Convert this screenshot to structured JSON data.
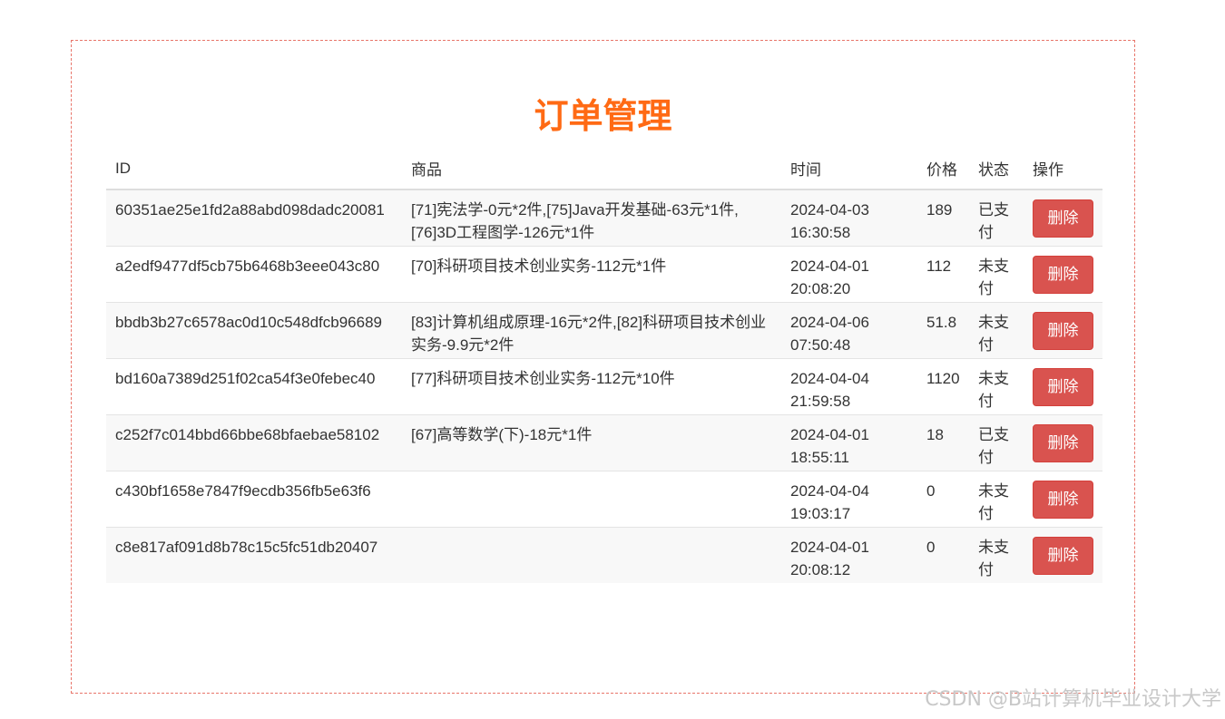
{
  "page": {
    "title": "订单管理"
  },
  "table": {
    "headers": [
      "ID",
      "商品",
      "时间",
      "价格",
      "状态",
      "操作"
    ],
    "rows": [
      {
        "id": "60351ae25e1fd2a88abd098dadc20081",
        "goods": "[71]宪法学-0元*2件,[75]Java开发基础-63元*1件,[76]3D工程图学-126元*1件",
        "time_date": "2024-04-03",
        "time_clock": "16:30:58",
        "price": "189",
        "status": "已支付",
        "action": "删除"
      },
      {
        "id": "a2edf9477df5cb75b6468b3eee043c80",
        "goods": "[70]科研项目技术创业实务-112元*1件",
        "time_date": "2024-04-01",
        "time_clock": "20:08:20",
        "price": "112",
        "status": "未支付",
        "action": "删除"
      },
      {
        "id": "bbdb3b27c6578ac0d10c548dfcb96689",
        "goods": "[83]计算机组成原理-16元*2件,[82]科研项目技术创业实务-9.9元*2件",
        "time_date": "2024-04-06",
        "time_clock": "07:50:48",
        "price": "51.8",
        "status": "未支付",
        "action": "删除"
      },
      {
        "id": "bd160a7389d251f02ca54f3e0febec40",
        "goods": "[77]科研项目技术创业实务-112元*10件",
        "time_date": "2024-04-04",
        "time_clock": "21:59:58",
        "price": "1120",
        "status": "未支付",
        "action": "删除"
      },
      {
        "id": "c252f7c014bbd66bbe68bfaebae58102",
        "goods": "[67]高等数学(下)-18元*1件",
        "time_date": "2024-04-01",
        "time_clock": "18:55:11",
        "price": "18",
        "status": "已支付",
        "action": "删除"
      },
      {
        "id": "c430bf1658e7847f9ecdb356fb5e63f6",
        "goods": "",
        "time_date": "2024-04-04",
        "time_clock": "19:03:17",
        "price": "0",
        "status": "未支付",
        "action": "删除"
      },
      {
        "id": "c8e817af091d8b78c15c5fc51db20407",
        "goods": "",
        "time_date": "2024-04-01",
        "time_clock": "20:08:12",
        "price": "0",
        "status": "未支付",
        "action": "删除"
      }
    ]
  },
  "watermark": "CSDN @B站计算机毕业设计大学",
  "colors": {
    "title": "#ff6a14",
    "delete_button": "#d9534f",
    "panel_border": "#e8756a"
  }
}
